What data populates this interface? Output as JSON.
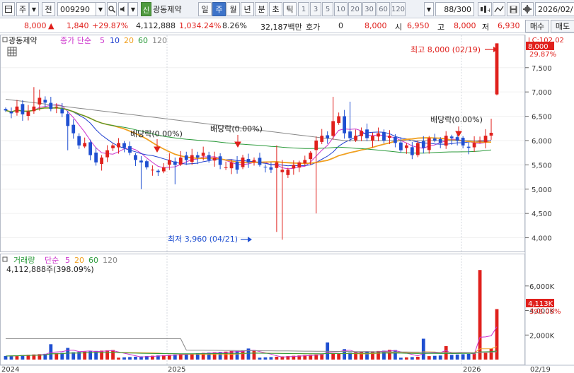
{
  "toolbar": {
    "market_label": "주",
    "jeon_label": "전",
    "code": "009290",
    "new_badge": "신",
    "stock_name": "광동제약",
    "periods": [
      "일",
      "주",
      "월",
      "년",
      "분",
      "초",
      "틱"
    ],
    "active_period": "주",
    "intervals": [
      "1",
      "3",
      "5",
      "10",
      "20",
      "30",
      "60",
      "120"
    ],
    "count": "88/300",
    "date": "2026/02/"
  },
  "quote": {
    "price": "8,000",
    "change": "1,840",
    "change_rate": "+29.87%",
    "volume": "4,112,888",
    "volume_rate": "1,034.24%",
    "turnover": "8.26%",
    "amount": "32,187백만",
    "hoga_label": "호가",
    "hoga_value": "0",
    "ask": "8,000",
    "open_label": "시",
    "open": "6,950",
    "high_label": "고",
    "high": "8,000",
    "low_label": "저",
    "low": "6,930",
    "buy_label": "매수",
    "sell_label": "매도"
  },
  "price_panel": {
    "title": "광동제약",
    "ma_label": "종가 단순",
    "ma_periods": [
      "5",
      "10",
      "20",
      "60",
      "120"
    ],
    "ma_colors": [
      "#cc33cc",
      "#1f3fd0",
      "#f0a020",
      "#2a9a3a",
      "#888888"
    ],
    "max_annot": "최고 8,000 (02/19)",
    "min_annot": "최저 3,960 (04/21)",
    "dividend_label": "배당락(0.00%)",
    "current_price_tag": "8,000",
    "current_rate_tag": "29.87%",
    "lc_tag": "LC:102.02"
  },
  "volume_panel": {
    "title": "거래량",
    "ma_label": "단순",
    "ma_periods": [
      "5",
      "20",
      "60",
      "120"
    ],
    "ma_colors": [
      "#cc33cc",
      "#f0a020",
      "#2a9a3a",
      "#888888"
    ],
    "current": "4,112,888주(398.09%)",
    "current_tag": "4,113K",
    "current_rate_tag": "398.09%"
  },
  "axis": {
    "price_ticks": [
      "7,500",
      "7,000",
      "6,500",
      "6,000",
      "5,500",
      "5,000",
      "4,500",
      "4,000"
    ],
    "volume_ticks": [
      "6,000K",
      "4,000K",
      "2,000K"
    ],
    "date_labels": [
      "2024",
      "2025",
      "2026",
      "02/19"
    ]
  },
  "chart_data": {
    "type": "candlestick",
    "ylim": [
      3800,
      8200
    ],
    "weeks": 88,
    "ohlc_sample": [
      {
        "week": 1,
        "open": 6650,
        "high": 6820,
        "low": 6550,
        "close": 6700
      },
      {
        "week": 86,
        "open": 6150,
        "high": 6450,
        "low": 6100,
        "close": 6160
      },
      {
        "week": 88,
        "open": 6950,
        "high": 8000,
        "low": 6930,
        "close": 8000
      }
    ],
    "max": {
      "price": 8000,
      "date": "02/19"
    },
    "min": {
      "price": 3960,
      "date": "04/21"
    },
    "volume_ylim": [
      0,
      7600000
    ]
  }
}
